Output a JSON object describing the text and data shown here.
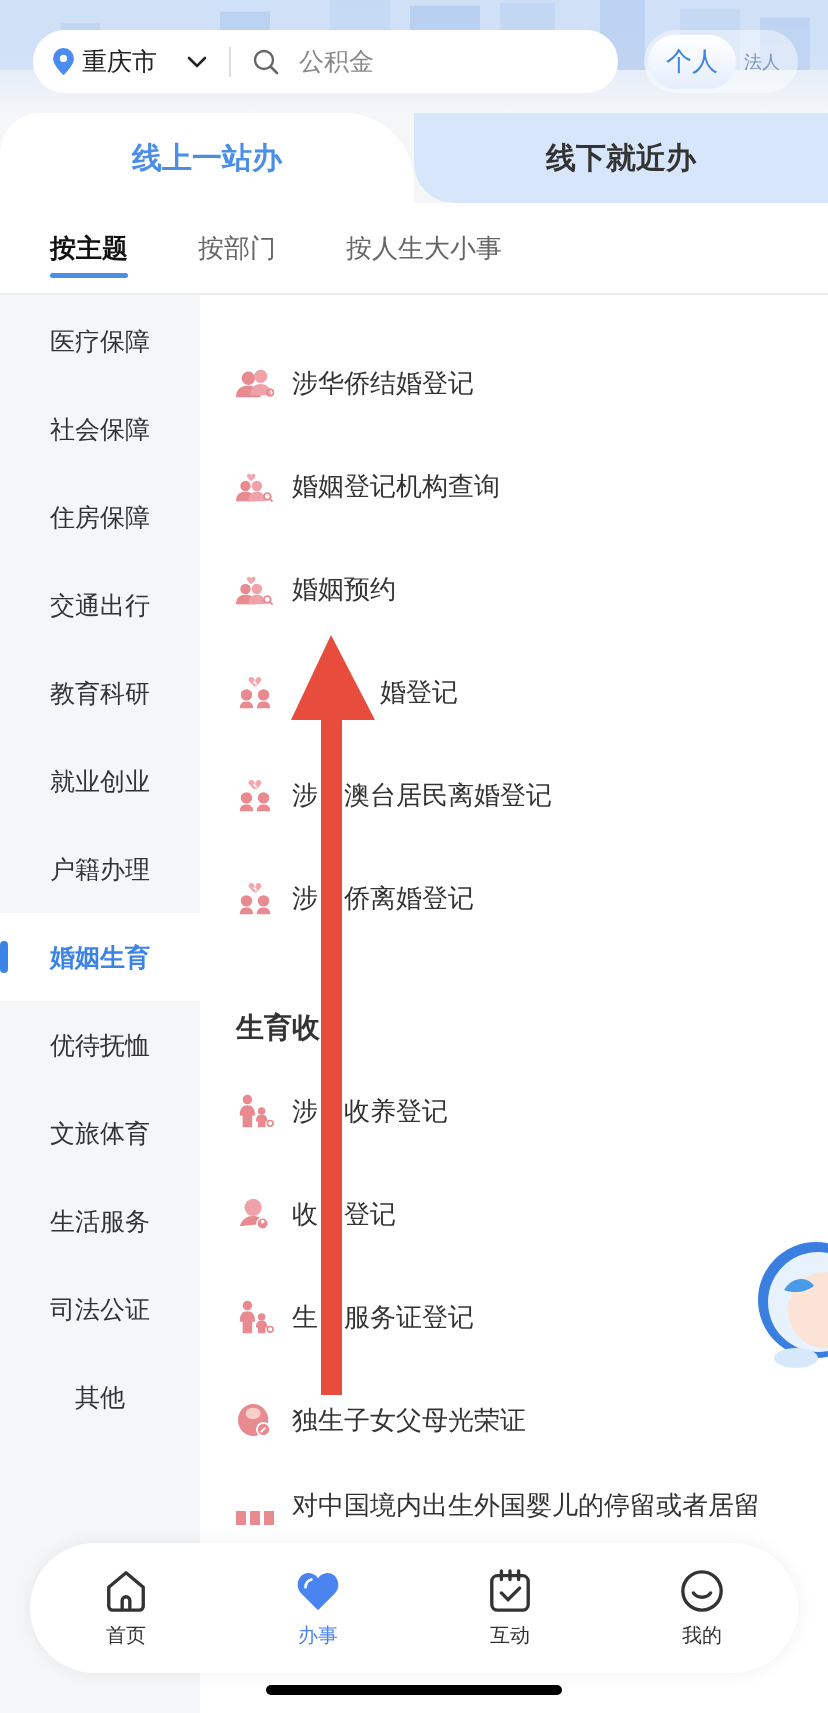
{
  "location": {
    "city": "重庆市"
  },
  "search": {
    "placeholder": "公积金"
  },
  "identity_toggle": [
    {
      "label": "个人",
      "selected": true
    },
    {
      "label": "法人",
      "selected": false
    }
  ],
  "mode_tabs": [
    {
      "label": "线上一站办",
      "selected": true
    },
    {
      "label": "线下就近办",
      "selected": false
    }
  ],
  "filter_tabs": [
    {
      "label": "按主题",
      "selected": true
    },
    {
      "label": "按部门",
      "selected": false
    },
    {
      "label": "按人生大小事",
      "selected": false
    }
  ],
  "sidebar": [
    {
      "label": "医疗保障",
      "selected": false
    },
    {
      "label": "社会保障",
      "selected": false
    },
    {
      "label": "住房保障",
      "selected": false
    },
    {
      "label": "交通出行",
      "selected": false
    },
    {
      "label": "教育科研",
      "selected": false
    },
    {
      "label": "就业创业",
      "selected": false
    },
    {
      "label": "户籍办理",
      "selected": false
    },
    {
      "label": "婚姻生育",
      "selected": true
    },
    {
      "label": "优待抚恤",
      "selected": false
    },
    {
      "label": "文旅体育",
      "selected": false
    },
    {
      "label": "生活服务",
      "selected": false
    },
    {
      "label": "司法公证",
      "selected": false
    },
    {
      "label": "其他",
      "selected": false
    }
  ],
  "services": [
    {
      "kind": "item",
      "label": "涉华侨结婚登记"
    },
    {
      "kind": "item",
      "label": "婚姻登记机构查询"
    },
    {
      "kind": "item",
      "label": "婚姻预约"
    },
    {
      "kind": "tip",
      "after": "婚登记"
    },
    {
      "kind": "split",
      "before": "涉",
      "after": "澳台居民离婚登记"
    },
    {
      "kind": "split",
      "before": "涉",
      "after": "侨离婚登记"
    },
    {
      "kind": "heading",
      "label": "生育收"
    },
    {
      "kind": "split",
      "before": "涉",
      "after": "收养登记"
    },
    {
      "kind": "split",
      "before": "收",
      "after": "登记"
    },
    {
      "kind": "split",
      "before": "生",
      "after": "服务证登记"
    },
    {
      "kind": "item",
      "label": "独生子女父母光荣证"
    },
    {
      "kind": "item",
      "label": "对中国境内出生外国婴儿的停留或者居留"
    }
  ],
  "bottom_nav": [
    {
      "label": "首页",
      "selected": false
    },
    {
      "label": "办事",
      "selected": true
    },
    {
      "label": "互动",
      "selected": false
    },
    {
      "label": "我的",
      "selected": false
    }
  ]
}
